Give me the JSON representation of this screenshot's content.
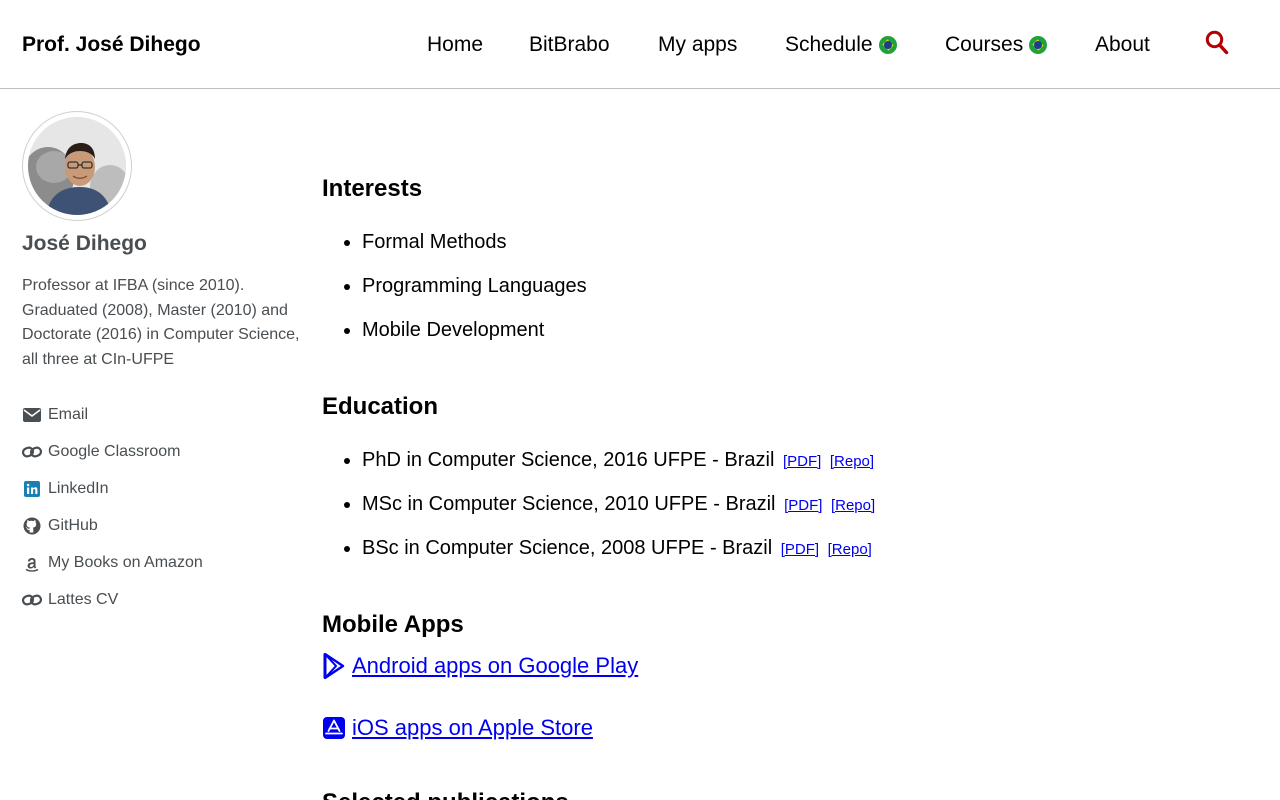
{
  "header": {
    "site_title": "Prof. José Dihego",
    "nav": [
      {
        "label": "Home",
        "flag": false
      },
      {
        "label": "BitBrabo",
        "flag": false
      },
      {
        "label": "My apps",
        "flag": false
      },
      {
        "label": "Schedule",
        "flag": true
      },
      {
        "label": "Courses",
        "flag": true
      },
      {
        "label": "About",
        "flag": false
      }
    ],
    "search_icon": "search-icon",
    "accent_color": "#b30000"
  },
  "sidebar": {
    "name": "José Dihego",
    "bio": "Professor at IFBA (since 2010). Graduated (2008), Master (2010) and Doctorate (2016) in Computer Science, all three at CIn-UFPE",
    "links": [
      {
        "label": "Email",
        "icon": "envelope-icon"
      },
      {
        "label": "Google Classroom",
        "icon": "link-icon"
      },
      {
        "label": "LinkedIn",
        "icon": "linkedin-icon"
      },
      {
        "label": "GitHub",
        "icon": "github-icon"
      },
      {
        "label": "My Books on Amazon",
        "icon": "amazon-icon"
      },
      {
        "label": "Lattes CV",
        "icon": "link-icon"
      }
    ]
  },
  "main": {
    "interests": {
      "title": "Interests",
      "items": [
        "Formal Methods",
        "Programming Languages",
        "Mobile Development"
      ]
    },
    "education": {
      "title": "Education",
      "items": [
        {
          "text": "PhD in Computer Science, 2016 UFPE - Brazil",
          "pdf": "[PDF]",
          "repo": "[Repo]"
        },
        {
          "text": "MSc in Computer Science, 2010 UFPE - Brazil",
          "pdf": "[PDF]",
          "repo": "[Repo]"
        },
        {
          "text": "BSc in Computer Science, 2008 UFPE - Brazil",
          "pdf": "[PDF]",
          "repo": "[Repo]"
        }
      ]
    },
    "mobile_apps": {
      "title": "Mobile Apps",
      "android": " Android apps on Google Play",
      "ios": " iOS apps on Apple Store"
    },
    "publications": {
      "title": "Selected publications"
    }
  }
}
